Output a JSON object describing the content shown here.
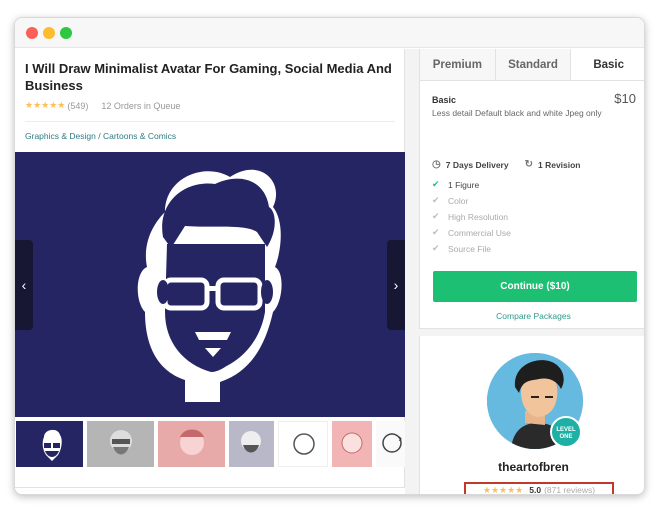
{
  "gig": {
    "title": "I Will Draw Minimalist Avatar For Gaming, Social Media And Business",
    "stars": "★★★★★",
    "rating_count": "(549)",
    "queue": "12 Orders in Queue",
    "breadcrumb": "Graphics & Design / Cartoons & Comics",
    "hero_bg": "#262564"
  },
  "gallery": {
    "prev_icon": "‹",
    "next_icon": "›",
    "thumb_next_icon": "›"
  },
  "packages": {
    "tabs": [
      "Premium",
      "Standard",
      "Basic"
    ],
    "active_tab": "Basic",
    "name": "Basic",
    "price": "$10",
    "description": "Less detail Default black and white Jpeg only",
    "delivery": "7 Days Delivery",
    "revisions": "1 Revision",
    "features": [
      {
        "label": "1 Figure",
        "included": true
      },
      {
        "label": "Color",
        "included": false
      },
      {
        "label": "High Resolution",
        "included": false
      },
      {
        "label": "Commercial Use",
        "included": false
      },
      {
        "label": "Source File",
        "included": false
      }
    ],
    "continue_label": "Continue ($10)",
    "compare_label": "Compare Packages",
    "accent": "#1dbf73"
  },
  "seller": {
    "level_line1": "LEVEL",
    "level_line2": "ONE",
    "name": "theartofbren",
    "stars": "★★★★★",
    "score": "5.0",
    "reviews": "(871 reviews)"
  }
}
